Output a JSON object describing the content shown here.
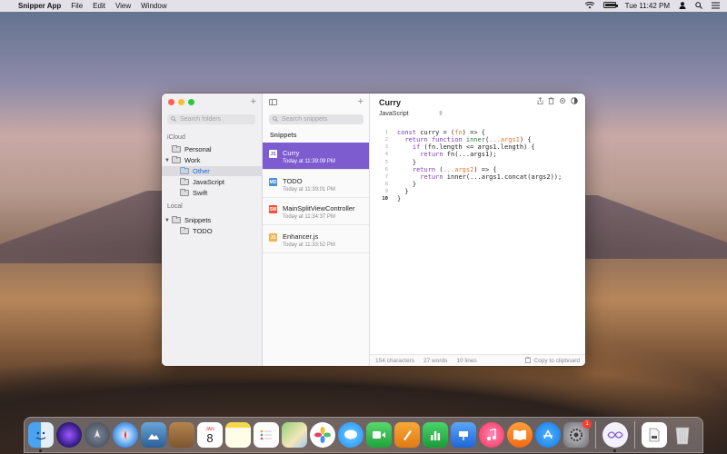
{
  "menubar": {
    "apple_glyph": "",
    "app_name": "Snipper App",
    "menus": [
      "File",
      "Edit",
      "View",
      "Window"
    ],
    "clock": "Tue 11:42 PM"
  },
  "folders_pane": {
    "search_placeholder": "Search folders",
    "icloud_label": "iCloud",
    "local_label": "Local",
    "icloud_items": [
      {
        "label": "Personal"
      },
      {
        "label": "Work"
      },
      {
        "label": "Other"
      },
      {
        "label": "JavaScript"
      },
      {
        "label": "Swift"
      }
    ],
    "local_items": [
      {
        "label": "Snippets"
      },
      {
        "label": "TODO"
      }
    ]
  },
  "snippets_pane": {
    "search_placeholder": "Search snippets",
    "header": "Snippets",
    "items": [
      {
        "title": "Curry",
        "date": "Today at 11:39:09 PM",
        "icon_label": "JS",
        "color": "#f2c94c"
      },
      {
        "title": "TODO",
        "date": "Today at 11:39:01 PM",
        "icon_label": "MD",
        "color": "#4a90d9"
      },
      {
        "title": "MainSplitViewController",
        "date": "Today at 11:34:37 PM",
        "icon_label": "SW",
        "color": "#f05138"
      },
      {
        "title": "Enhancer.js",
        "date": "Today at 11:33:52 PM",
        "icon_label": "JS",
        "color": "#f2b24c"
      }
    ]
  },
  "editor": {
    "title": "Curry",
    "language": "JavaScript",
    "line_numbers": [
      "1",
      "2",
      "3",
      "4",
      "5",
      "6",
      "7",
      "8",
      "9",
      "10"
    ],
    "footer": {
      "characters": "154 characters",
      "words": "27 words",
      "lines": "10 lines",
      "copy": "Copy to clipboard"
    }
  },
  "colors": {
    "accent": "#7d5ccf",
    "close": "#fc5f57",
    "minimize": "#fdbc2e",
    "maximize": "#29c840"
  },
  "dock": {
    "apps": [
      "finder-icon",
      "siri-icon",
      "launchpad-icon",
      "safari-icon",
      "photo-browser-icon",
      "contacts-icon",
      "calendar-icon",
      "notes-icon",
      "reminders-icon",
      "maps-icon",
      "photos-icon",
      "messages-icon",
      "facetime-icon",
      "pages-icon",
      "numbers-icon",
      "keynote-icon",
      "music-icon",
      "books-icon",
      "app-store-icon",
      "system-preferences-icon",
      "snipper-icon",
      "downloads-icon",
      "trash-icon"
    ],
    "calendar_day": "8",
    "calendar_month": "JAN",
    "prefs_badge": "1"
  }
}
